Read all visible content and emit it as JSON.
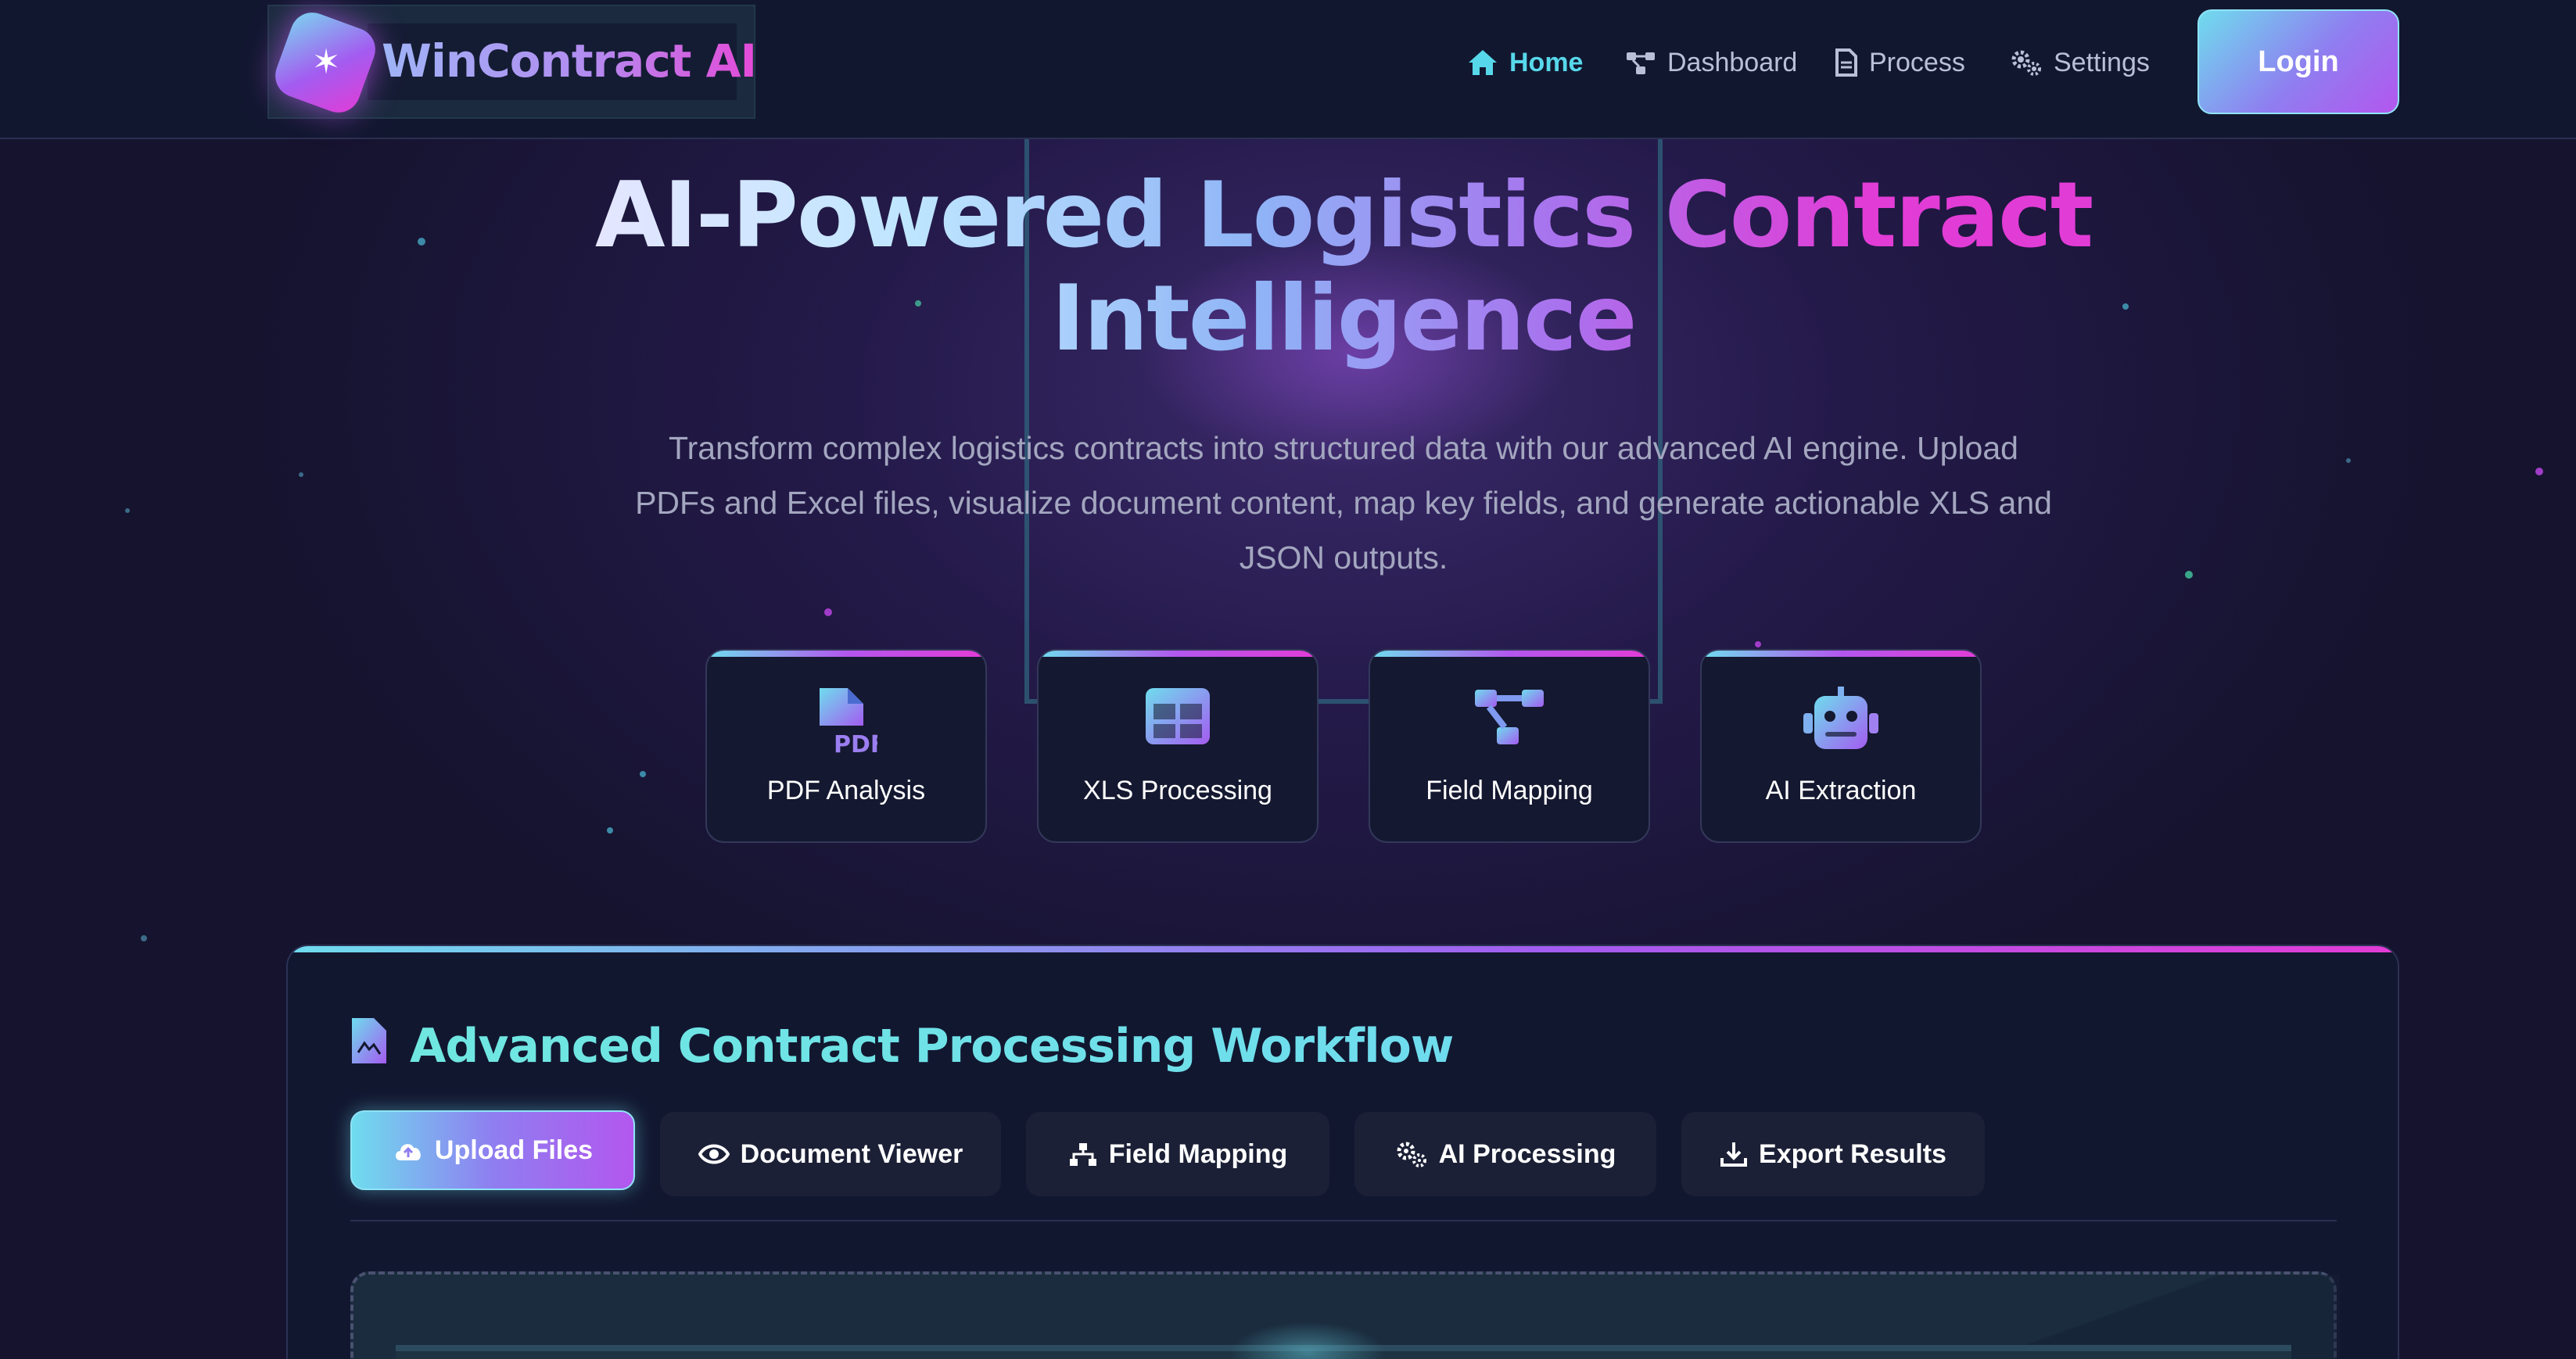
{
  "brand": {
    "name": "WinContract AI"
  },
  "nav": {
    "items": [
      {
        "label": "Home",
        "icon": "home-icon",
        "active": true
      },
      {
        "label": "Dashboard",
        "icon": "network-icon",
        "active": false
      },
      {
        "label": "Process",
        "icon": "file-icon",
        "active": false
      },
      {
        "label": "Settings",
        "icon": "gears-icon",
        "active": false
      }
    ],
    "login_label": "Login"
  },
  "hero": {
    "title_line1": "AI-Powered Logistics Contract",
    "title_line2": "Intelligence",
    "description": "Transform complex logistics contracts into structured data with our advanced AI engine. Upload PDFs and Excel files, visualize document content, map key fields, and generate actionable XLS and JSON outputs."
  },
  "features": [
    {
      "label": "PDF Analysis",
      "icon": "pdf-file-icon"
    },
    {
      "label": "XLS Processing",
      "icon": "table-icon"
    },
    {
      "label": "Field Mapping",
      "icon": "sitemap-icon"
    },
    {
      "label": "AI Extraction",
      "icon": "robot-icon"
    }
  ],
  "workflow": {
    "title": "Advanced Contract Processing Workflow",
    "tabs": [
      {
        "label": "Upload Files",
        "icon": "cloud-upload-icon",
        "active": true
      },
      {
        "label": "Document Viewer",
        "icon": "eye-icon",
        "active": false
      },
      {
        "label": "Field Mapping",
        "icon": "sitemap-icon",
        "active": false
      },
      {
        "label": "AI Processing",
        "icon": "gears-icon",
        "active": false
      },
      {
        "label": "Export Results",
        "icon": "download-icon",
        "active": false
      }
    ]
  },
  "colors": {
    "accent_cyan": "#6fdcee",
    "accent_purple": "#a35cf0",
    "accent_magenta": "#e23cd6",
    "background": "#15132e",
    "header": "#121730"
  }
}
